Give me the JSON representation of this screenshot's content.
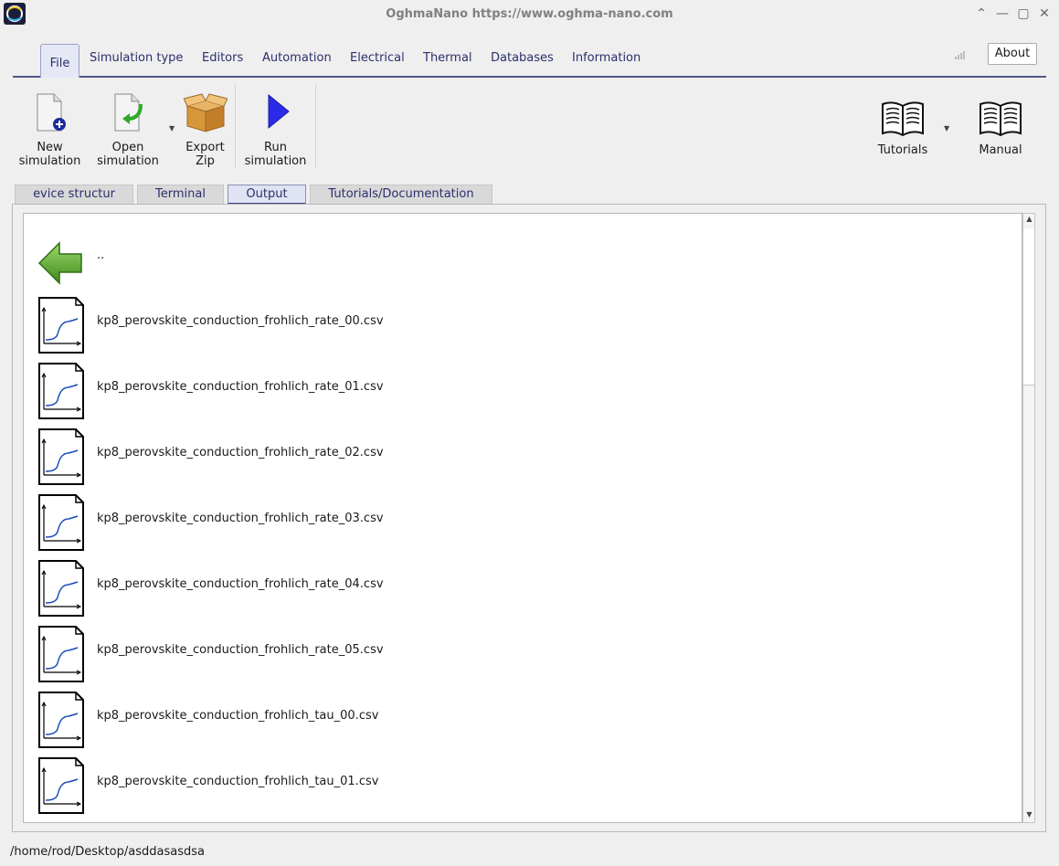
{
  "window": {
    "title": "OghmaNano https://www.oghma-nano.com",
    "controls": {
      "collapse": "⌃",
      "minimize": "—",
      "maximize": "▢",
      "close": "✕"
    }
  },
  "menu": {
    "tabs": [
      "File",
      "Simulation type",
      "Editors",
      "Automation",
      "Electrical",
      "Thermal",
      "Databases",
      "Information"
    ],
    "about": "About"
  },
  "toolbar": {
    "new_line1": "New",
    "new_line2": "simulation",
    "open_line1": "Open",
    "open_line2": "simulation",
    "export_line1": "Export",
    "export_line2": "Zip",
    "run_line1": "Run",
    "run_line2": "simulation",
    "tutorials": "Tutorials",
    "manual": "Manual"
  },
  "view_tabs": [
    "evice structur",
    "Terminal",
    "Output",
    "Tutorials/Documentation"
  ],
  "files": [
    {
      "name": "..",
      "icon": "back-arrow-icon"
    },
    {
      "name": "kp8_perovskite_conduction_frohlich_rate_00.csv",
      "icon": "graph-file-icon"
    },
    {
      "name": "kp8_perovskite_conduction_frohlich_rate_01.csv",
      "icon": "graph-file-icon"
    },
    {
      "name": "kp8_perovskite_conduction_frohlich_rate_02.csv",
      "icon": "graph-file-icon"
    },
    {
      "name": "kp8_perovskite_conduction_frohlich_rate_03.csv",
      "icon": "graph-file-icon"
    },
    {
      "name": "kp8_perovskite_conduction_frohlich_rate_04.csv",
      "icon": "graph-file-icon"
    },
    {
      "name": "kp8_perovskite_conduction_frohlich_rate_05.csv",
      "icon": "graph-file-icon"
    },
    {
      "name": "kp8_perovskite_conduction_frohlich_tau_00.csv",
      "icon": "graph-file-icon"
    },
    {
      "name": "kp8_perovskite_conduction_frohlich_tau_01.csv",
      "icon": "graph-file-icon"
    }
  ],
  "status": {
    "path": "/home/rod/Desktop/asddasasdsa"
  },
  "colors": {
    "accent": "#2b2f6b",
    "run_arrow": "#2a2ae8",
    "back_arrow": "#5aa82a"
  }
}
